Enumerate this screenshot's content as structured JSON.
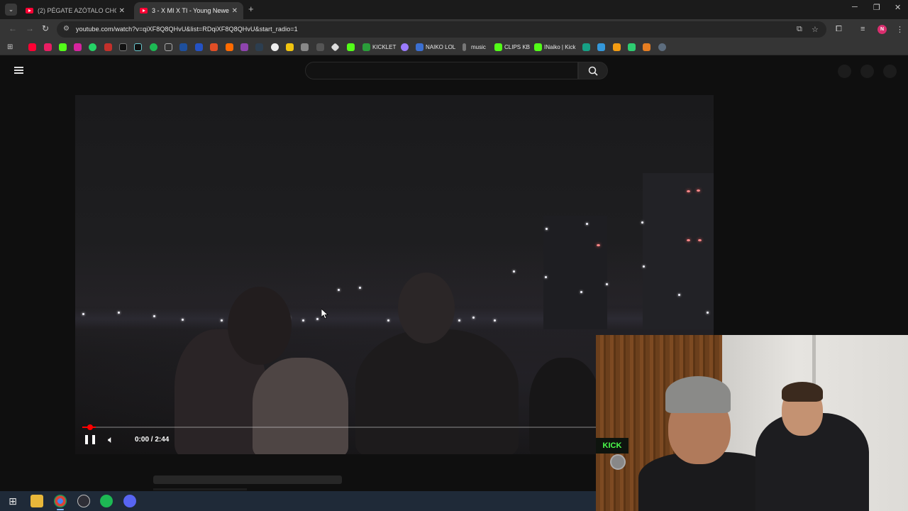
{
  "browser": {
    "tabs": [
      {
        "title": "(2) PÉGATE AZÓTALO CHÓ",
        "active": false
      },
      {
        "title": "3 - X MI X TI - Young Newe",
        "active": true
      }
    ],
    "new_tab_label": "+",
    "tab_close_label": "✕",
    "address": {
      "url": "youtube.com/watch?v=qiXF8Q8QHvU&list=RDqiXF8Q8QHvU&start_radio=1"
    },
    "bookmarks": [
      {
        "label": "KICKLET",
        "color": "#2a9d3a"
      },
      {
        "label": "NAIKO LOL",
        "color": "#3b6fd1"
      },
      {
        "label": "music",
        "color": "#777777"
      },
      {
        "label": "CLIPS KB",
        "color": "#53fc18"
      },
      {
        "label": "INaiko | Kick",
        "color": "#53fc18"
      }
    ],
    "profile_initial": "N"
  },
  "youtube": {
    "player": {
      "time": "0:00 / 2:44",
      "progress_fraction": 0.01
    }
  },
  "webcam": {
    "sticker_text": "KICK"
  },
  "taskbar": {
    "apps": [
      "start-icon",
      "file-explorer-icon",
      "chrome-icon",
      "obs-icon",
      "spotify-icon",
      "discord-icon"
    ]
  },
  "colors": {
    "accent_red": "#ff0000",
    "page_bg": "#0f0f0f",
    "chrome_bar": "#353535"
  }
}
